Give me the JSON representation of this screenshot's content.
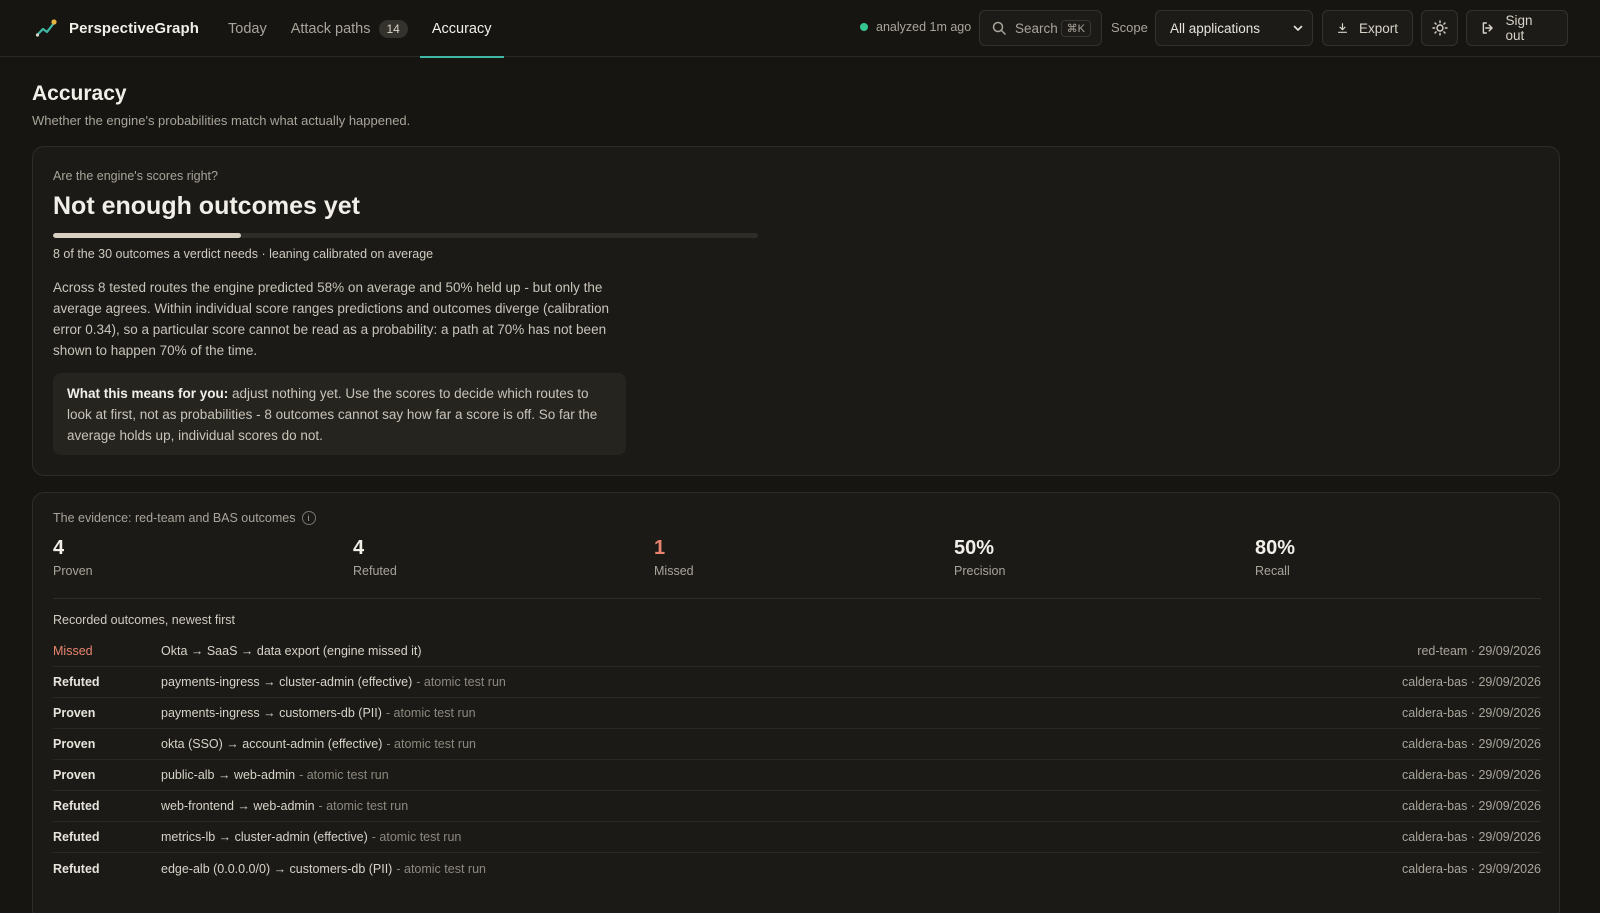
{
  "app": {
    "name": "PerspectiveGraph"
  },
  "nav": {
    "tabs": [
      {
        "label": "Today"
      },
      {
        "label": "Attack paths",
        "count": "14"
      },
      {
        "label": "Accuracy"
      }
    ],
    "active": "Accuracy"
  },
  "header": {
    "status": "analyzed 1m ago",
    "search_label": "Search",
    "search_shortcut": "⌘K",
    "scope_label": "Scope",
    "scope_value": "All applications",
    "export_label": "Export",
    "signout_label": "Sign out"
  },
  "page": {
    "title": "Accuracy",
    "subtitle": "Whether the engine's probabilities match what actually happened."
  },
  "calibration": {
    "question": "Are the engine's scores right?",
    "verdict": "Not enough outcomes yet",
    "progress_fraction": 0.2667,
    "progress_caption": "8 of the 30 outcomes a verdict needs · leaning calibrated on average",
    "explanation": "Across 8 tested routes the engine predicted 58% on average and 50% held up - but only the average agrees. Within individual score ranges predictions and outcomes diverge (calibration error 0.34), so a particular score cannot be read as a probability: a path at 70% has not been shown to happen 70% of the time.",
    "callout_lead": "What this means for you:",
    "callout_body": " adjust nothing yet. Use the scores to decide which routes to look at first, not as probabilities - 8 outcomes cannot say how far a score is off. So far the average holds up, individual scores do not."
  },
  "evidence": {
    "title": "The evidence: red-team and BAS outcomes",
    "info_glyph": "i",
    "stats": [
      {
        "value": "4",
        "label": "Proven"
      },
      {
        "value": "4",
        "label": "Refuted"
      },
      {
        "value": "1",
        "label": "Missed"
      },
      {
        "value": "50%",
        "label": "Precision"
      },
      {
        "value": "80%",
        "label": "Recall"
      }
    ],
    "list_title": "Recorded outcomes, newest first",
    "outcomes": [
      {
        "verdict": "Missed",
        "route": "Okta → SaaS → data export (engine missed it)",
        "note": "",
        "source": "red-team · 29/09/2026"
      },
      {
        "verdict": "Refuted",
        "route": "payments-ingress → cluster-admin (effective)",
        "note": "- atomic test run",
        "source": "caldera-bas · 29/09/2026"
      },
      {
        "verdict": "Proven",
        "route": "payments-ingress → customers-db (PII)",
        "note": "- atomic test run",
        "source": "caldera-bas · 29/09/2026"
      },
      {
        "verdict": "Proven",
        "route": "okta (SSO) → account-admin (effective)",
        "note": "- atomic test run",
        "source": "caldera-bas · 29/09/2026"
      },
      {
        "verdict": "Proven",
        "route": "public-alb → web-admin",
        "note": "- atomic test run",
        "source": "caldera-bas · 29/09/2026"
      },
      {
        "verdict": "Refuted",
        "route": "web-frontend → web-admin",
        "note": "- atomic test run",
        "source": "caldera-bas · 29/09/2026"
      },
      {
        "verdict": "Refuted",
        "route": "metrics-lb → cluster-admin (effective)",
        "note": "- atomic test run",
        "source": "caldera-bas · 29/09/2026"
      },
      {
        "verdict": "Refuted",
        "route": "edge-alb (0.0.0.0/0) → customers-db (PII)",
        "note": "- atomic test run",
        "source": "caldera-bas · 29/09/2026"
      }
    ]
  },
  "colors": {
    "accent": "#3fb8a6",
    "status_ok": "#34c58f",
    "missed": "#e8846d"
  }
}
